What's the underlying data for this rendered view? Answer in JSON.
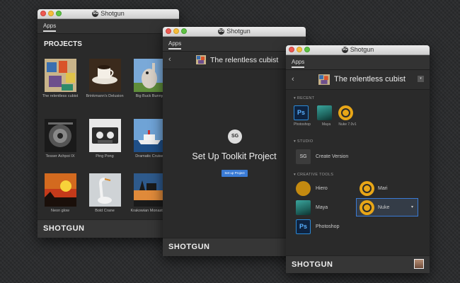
{
  "brand_colors": {
    "accent": "#3a7bd5",
    "nuke": "#e8a617",
    "photoshop": "#2b8ad8"
  },
  "window1": {
    "title": "Shotgun",
    "tab": "Apps",
    "heading": "PROJECTS",
    "projects": [
      {
        "name": "The relentless cubist"
      },
      {
        "name": "Brinkmann's Delusion"
      },
      {
        "name": "Big Buck Bunny"
      },
      {
        "name": "Tesser Achpoi IX"
      },
      {
        "name": "Ping Pong"
      },
      {
        "name": "Dramatic Cruise"
      },
      {
        "name": "Neon glow"
      },
      {
        "name": "Bold Crane"
      },
      {
        "name": "Krakowian Monastery"
      }
    ],
    "footer": "SHOTGUN"
  },
  "window2": {
    "title": "Shotgun",
    "tab": "Apps",
    "back_icon": "chevron-left-icon",
    "project_name": "The relentless cubist",
    "logo_text": "SG",
    "setup_title": "Set Up Toolkit Project",
    "setup_button": "Set up Project",
    "footer": "SHOTGUN"
  },
  "window3": {
    "title": "Shotgun",
    "tab": "Apps",
    "project_name": "The relentless cubist",
    "dropdown_icon": "▾",
    "recent_label": "▾ RECENT",
    "recent": [
      {
        "name": "Photoshop",
        "icon": "Ps"
      },
      {
        "name": "Maya"
      },
      {
        "name": "Nuke 7.0v1"
      }
    ],
    "studio_label": "▾ STUDIO",
    "studio": [
      {
        "name": "Create Version",
        "icon": "SG"
      }
    ],
    "creative_label": "▾ CREATIVE TOOLS",
    "creative": [
      {
        "name": "Hiero"
      },
      {
        "name": "Mari"
      },
      {
        "name": "Maya"
      },
      {
        "name": "Nuke"
      },
      {
        "name": "Photoshop",
        "icon": "Ps"
      }
    ],
    "nuke_dropdown": "▾",
    "footer": "SHOTGUN"
  }
}
